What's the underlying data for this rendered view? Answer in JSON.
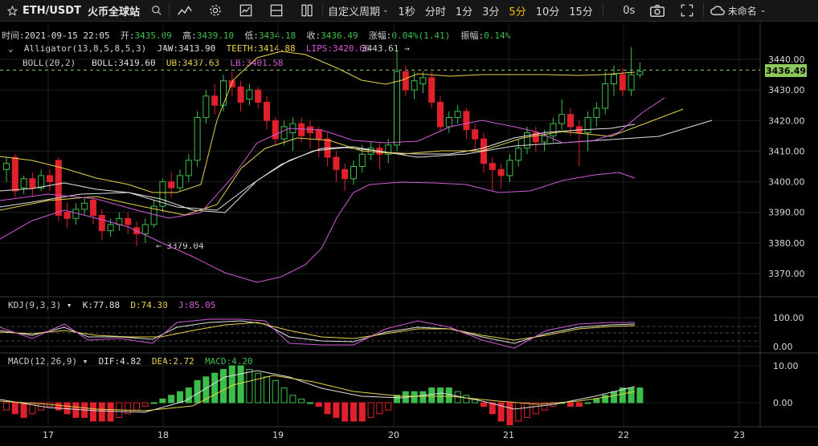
{
  "toolbar": {
    "symbol": "ETH/USDT",
    "exchange": "火币全球站",
    "custom_period": "自定义周期",
    "periods": [
      "1秒",
      "分时",
      "1分",
      "3分",
      "5分",
      "10分",
      "15分"
    ],
    "active_period": "5分",
    "countdown": "0s",
    "layout_name": "未命名",
    "icons": [
      "star-icon",
      "search-icon",
      "indicator-icon",
      "settings-icon",
      "chart-type-icon",
      "layout-icon",
      "columns-icon",
      "camera-icon",
      "fullscreen-icon",
      "cloud-icon"
    ]
  },
  "ohlc": {
    "time_label": "时间:",
    "time": "2021-09-15 22:05",
    "open_label": "开:",
    "open": "3435.09",
    "high_label": "高:",
    "high": "3439.10",
    "low_label": "低:",
    "low": "3434.18",
    "close_label": "收:",
    "close": "3436.49",
    "change_label": "涨幅:",
    "change": "0.04%(1.41)",
    "amp_label": "振幅:",
    "amp": "0.14%"
  },
  "alligator": {
    "name": "Alligator(13,8,5,8,5,3)",
    "jaw": "JAW:3413.90",
    "teeth": "TEETH:3414.88",
    "lips": "LIPS:3420.66"
  },
  "boll": {
    "name": "BOLL(20,2)",
    "boll": "BOLL:3419.60",
    "ub": "UB:3437.63",
    "lb": "LB:3401.58"
  },
  "annotations": {
    "high_mark": "3443.61 →",
    "low_mark": "← 3379.04"
  },
  "kdj": {
    "name": "KDJ(9,3,3)",
    "k": "K:77.88",
    "d": "D:74.30",
    "j": "J:85.05"
  },
  "macd": {
    "name": "MACD(12,26,9)",
    "dif": "DIF:4.82",
    "dea": "DEA:2.72",
    "macd": "MACD:4.20"
  },
  "price_axis": [
    "3440.00",
    "3430.00",
    "3420.00",
    "3410.00",
    "3400.00",
    "3390.00",
    "3380.00",
    "3370.00"
  ],
  "current_price": "3436.49",
  "kdj_axis": [
    "100.00",
    "0.00"
  ],
  "macd_axis": [
    "10.00",
    "0.00"
  ],
  "time_axis": [
    "17",
    "18",
    "19",
    "20",
    "21",
    "22",
    "23"
  ],
  "colors": {
    "up": "#3cbf4a",
    "down": "#e0202a",
    "accent": "#f0b90b",
    "price_tag": "#8cc95a"
  }
}
